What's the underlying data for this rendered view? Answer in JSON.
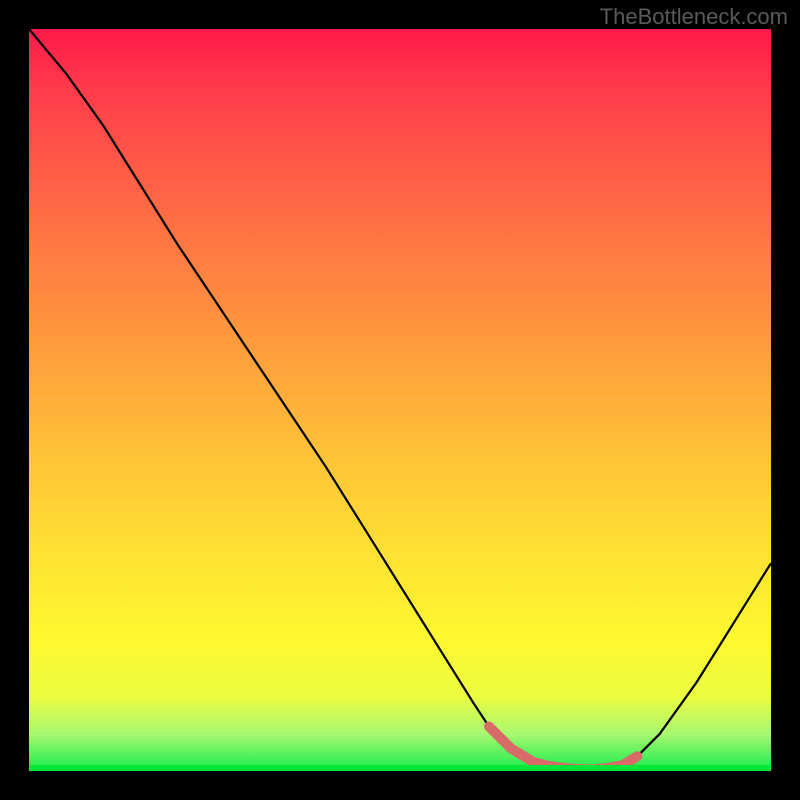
{
  "watermark": "TheBottleneck.com",
  "chart_data": {
    "type": "line",
    "title": "",
    "xlabel": "",
    "ylabel": "",
    "xlim": [
      0,
      100
    ],
    "ylim": [
      0,
      100
    ],
    "series": [
      {
        "name": "bottleneck-curve",
        "x": [
          0,
          5,
          10,
          15,
          20,
          25,
          30,
          35,
          40,
          45,
          50,
          55,
          60,
          62,
          65,
          68,
          72,
          76,
          80,
          82,
          85,
          90,
          95,
          100
        ],
        "y": [
          100,
          94,
          87,
          79,
          71,
          63.5,
          56,
          48.5,
          41,
          33,
          25,
          17,
          9,
          6,
          3,
          1.2,
          0.4,
          0.2,
          0.8,
          2,
          5,
          12,
          20,
          28
        ]
      },
      {
        "name": "highlight-segment",
        "x": [
          62,
          65,
          68,
          70,
          72,
          74,
          76,
          78,
          80,
          82
        ],
        "y": [
          6,
          3,
          1.2,
          0.7,
          0.4,
          0.25,
          0.2,
          0.4,
          0.8,
          2
        ]
      }
    ],
    "colors": {
      "curve": "#000000",
      "highlight": "#d96a6a",
      "gradient_top": "#ff1a4a",
      "gradient_bottom": "#00e836"
    }
  }
}
